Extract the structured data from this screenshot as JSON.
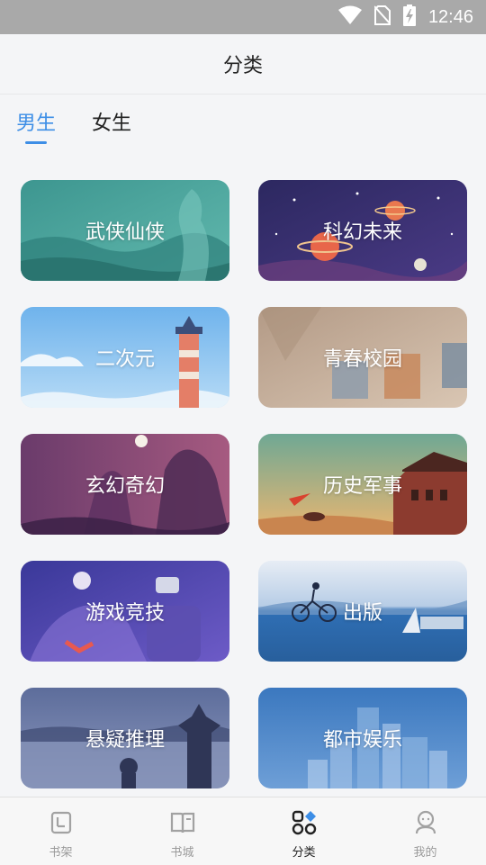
{
  "status_bar": {
    "time": "12:46",
    "icons": [
      "wifi-icon",
      "no-sim-icon",
      "battery-charging-icon"
    ]
  },
  "header": {
    "title": "分类"
  },
  "tabs": [
    {
      "label": "男生",
      "active": true
    },
    {
      "label": "女生",
      "active": false
    }
  ],
  "categories": [
    {
      "label": "武侠仙侠",
      "colors": [
        "#3f9c95",
        "#5bb7ad"
      ]
    },
    {
      "label": "科幻未来",
      "colors": [
        "#2f2a5e",
        "#4b3a86"
      ]
    },
    {
      "label": "二次元",
      "colors": [
        "#86c3ef",
        "#b8dcf6"
      ]
    },
    {
      "label": "青春校园",
      "colors": [
        "#b59c88",
        "#d6c1ad"
      ]
    },
    {
      "label": "玄幻奇幻",
      "colors": [
        "#6e3f6e",
        "#a45c82"
      ]
    },
    {
      "label": "历史军事",
      "colors": [
        "#5a9a8a",
        "#e8b067"
      ]
    },
    {
      "label": "游戏竞技",
      "colors": [
        "#3d3b9c",
        "#6a5ac7"
      ]
    },
    {
      "label": "出版",
      "colors": [
        "#2f6fb5",
        "#9ec4e4"
      ]
    },
    {
      "label": "悬疑推理",
      "colors": [
        "#5a6c9a",
        "#8c98bd"
      ]
    },
    {
      "label": "都市娱乐",
      "colors": [
        "#3f7cc1",
        "#8fb6e4"
      ]
    }
  ],
  "bottom_nav": [
    {
      "label": "书架",
      "icon": "bookshelf-icon",
      "active": false
    },
    {
      "label": "书城",
      "icon": "book-store-icon",
      "active": false
    },
    {
      "label": "分类",
      "icon": "category-grid-icon",
      "active": true
    },
    {
      "label": "我的",
      "icon": "profile-icon",
      "active": false
    }
  ]
}
